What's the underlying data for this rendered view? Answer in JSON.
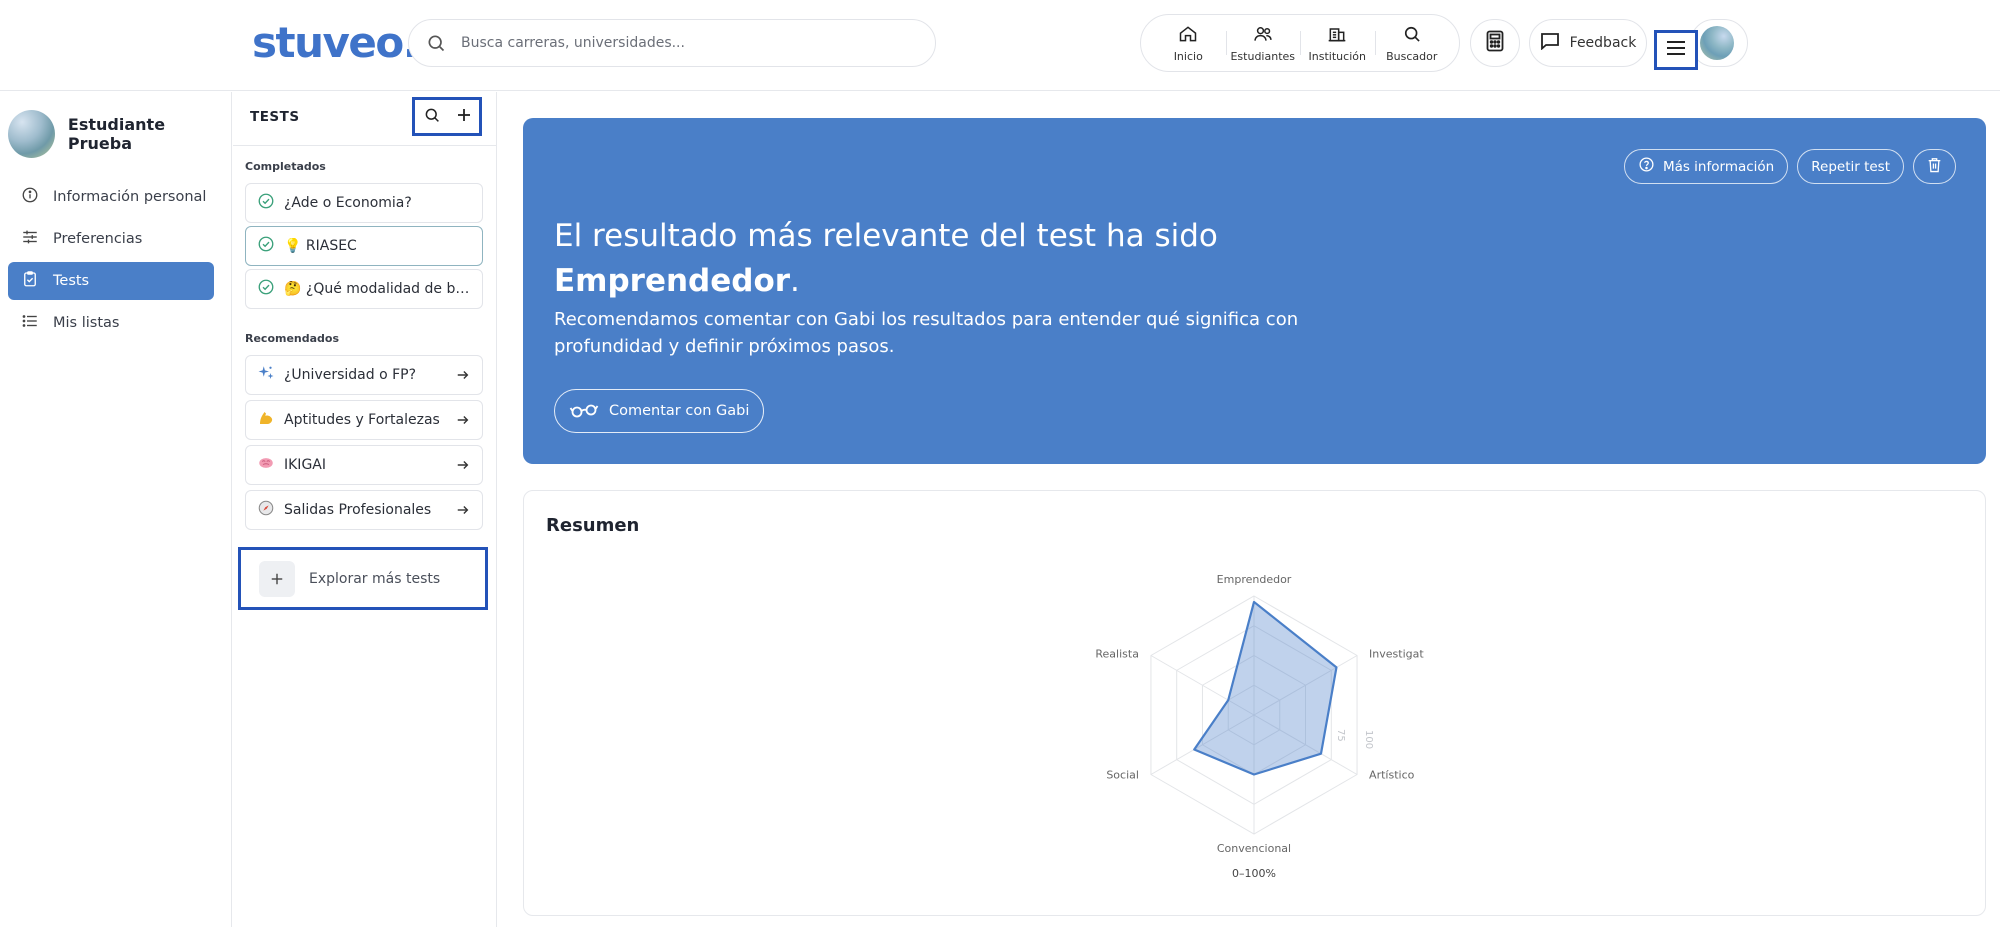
{
  "header": {
    "logo": "stuveo.",
    "search_placeholder": "Busca carreras, universidades...",
    "nav": [
      {
        "label": "Inicio",
        "icon": "home-icon"
      },
      {
        "label": "Estudiantes",
        "icon": "users-icon"
      },
      {
        "label": "Institución",
        "icon": "building-icon"
      },
      {
        "label": "Buscador",
        "icon": "search-icon"
      }
    ],
    "feedback_label": "Feedback"
  },
  "sidebar": {
    "user_name": "Estudiante Prueba",
    "items": [
      {
        "label": "Información personal",
        "icon": "info-icon",
        "active": false
      },
      {
        "label": "Preferencias",
        "icon": "sliders-icon",
        "active": true
      },
      {
        "label": "Tests",
        "icon": "clipboard-icon",
        "active": true
      },
      {
        "label": "Mis listas",
        "icon": "list-icon",
        "active": false
      }
    ]
  },
  "tests_panel": {
    "title": "TESTS",
    "completed_label": "Completados",
    "completed": [
      {
        "label": "¿Ade o Economia?"
      },
      {
        "label": "💡 RIASEC"
      },
      {
        "label": "🤔 ¿Qué modalidad de bachillerato"
      }
    ],
    "recommended_label": "Recomendados",
    "recommended": [
      {
        "label": "¿Universidad o FP?",
        "icon": "sparkles-icon"
      },
      {
        "label": "Aptitudes y Fortalezas",
        "icon": "muscle-icon"
      },
      {
        "label": "IKIGAI",
        "icon": "brain-icon"
      },
      {
        "label": "Salidas Profesionales",
        "icon": "compass-icon"
      }
    ],
    "explore_label": "Explorar más tests"
  },
  "banner": {
    "buttons": {
      "more_info": "Más información",
      "repeat": "Repetir test"
    },
    "headline_prefix": "El resultado más relevante del test ha sido",
    "headline_result": "Emprendedor",
    "headline_suffix": ".",
    "description": "Recomendamos comentar con Gabi los resultados para entender qué significa con profundidad y definir próximos pasos.",
    "cta": "Comentar con Gabi"
  },
  "resumen": {
    "title": "Resumen",
    "scale_label": "0–100%"
  },
  "chart_data": {
    "type": "radar",
    "categories": [
      "Emprendedor",
      "Investigativo",
      "Artístico",
      "Convencional",
      "Social",
      "Realista"
    ],
    "values": [
      95,
      80,
      65,
      50,
      58,
      25
    ],
    "range": [
      0,
      100
    ],
    "tick_labels": [
      "75",
      "100"
    ],
    "color": "#4a7fc8"
  },
  "colors": {
    "accent": "#4a7fc8",
    "brand": "#3f73c9",
    "highlight_border": "#2352b8"
  }
}
